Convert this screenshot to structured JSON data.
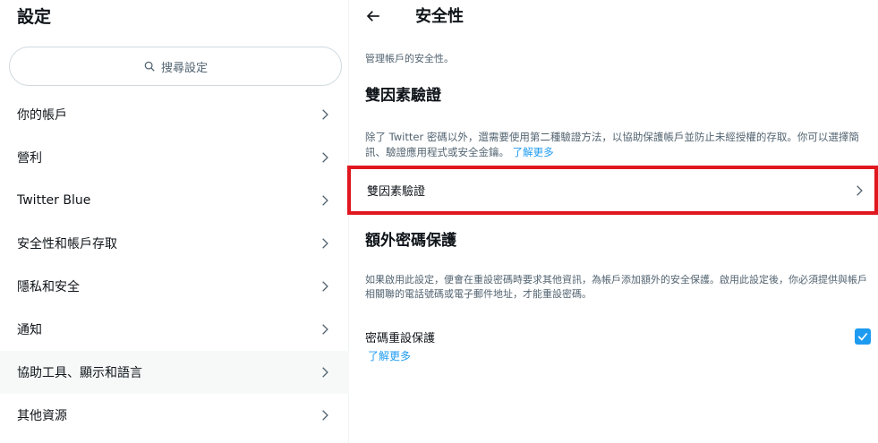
{
  "left": {
    "title": "設定",
    "search_placeholder": "搜尋設定",
    "search_icon": "search-icon",
    "menu": [
      {
        "label": "你的帳戶"
      },
      {
        "label": "營利"
      },
      {
        "label": "Twitter Blue"
      },
      {
        "label": "安全性和帳戶存取"
      },
      {
        "label": "隱私和安全"
      },
      {
        "label": "通知"
      },
      {
        "label": "協助工具、顯示和語言",
        "active": true
      },
      {
        "label": "其他資源"
      }
    ]
  },
  "right": {
    "title": "安全性",
    "subtitle": "管理帳戶的安全性。",
    "two_factor": {
      "heading": "雙因素驗證",
      "description": "除了 Twitter 密碼以外，還需要使用第二種驗證方法，以協助保護帳戶並防止未經授權的存取。你可以選擇簡訊、驗證應用程式或安全金鑰。",
      "learn_more": "了解更多",
      "row_label": "雙因素驗證"
    },
    "extra_password": {
      "heading": "額外密碼保護",
      "description": "如果啟用此設定，便會在重設密碼時要求其他資訊，為帳戶添加額外的安全保護。啟用此設定後，你必須提供與帳戶相關聯的電話號碼或電子郵件地址，才能重設密碼。",
      "toggle_label": "密碼重設保護",
      "toggle_checked": true,
      "learn_more": "了解更多"
    }
  },
  "colors": {
    "accent": "#1d9bf0",
    "highlight_border": "#e0161e",
    "text_primary": "#0f1419",
    "text_secondary": "#536471"
  }
}
